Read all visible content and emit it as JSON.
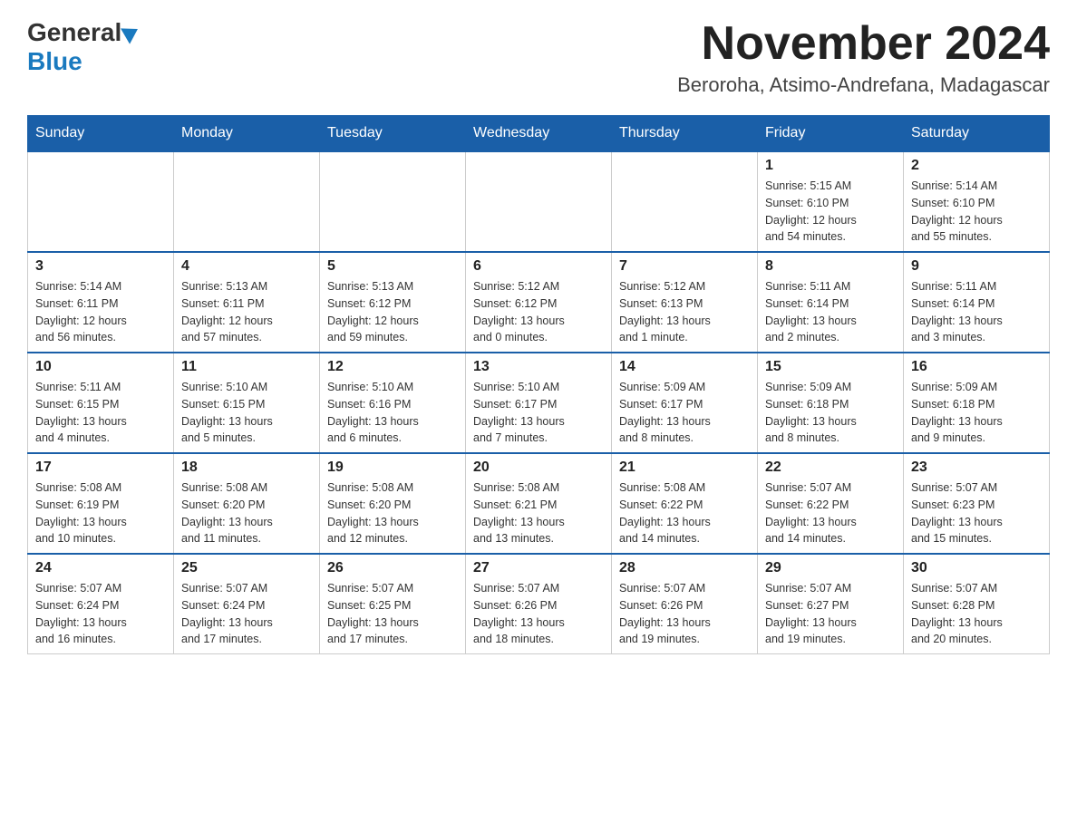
{
  "header": {
    "logo_general": "General",
    "logo_blue": "Blue",
    "month_title": "November 2024",
    "location": "Beroroha, Atsimo-Andrefana, Madagascar"
  },
  "weekdays": [
    "Sunday",
    "Monday",
    "Tuesday",
    "Wednesday",
    "Thursday",
    "Friday",
    "Saturday"
  ],
  "weeks": [
    [
      {
        "day": "",
        "info": ""
      },
      {
        "day": "",
        "info": ""
      },
      {
        "day": "",
        "info": ""
      },
      {
        "day": "",
        "info": ""
      },
      {
        "day": "",
        "info": ""
      },
      {
        "day": "1",
        "info": "Sunrise: 5:15 AM\nSunset: 6:10 PM\nDaylight: 12 hours\nand 54 minutes."
      },
      {
        "day": "2",
        "info": "Sunrise: 5:14 AM\nSunset: 6:10 PM\nDaylight: 12 hours\nand 55 minutes."
      }
    ],
    [
      {
        "day": "3",
        "info": "Sunrise: 5:14 AM\nSunset: 6:11 PM\nDaylight: 12 hours\nand 56 minutes."
      },
      {
        "day": "4",
        "info": "Sunrise: 5:13 AM\nSunset: 6:11 PM\nDaylight: 12 hours\nand 57 minutes."
      },
      {
        "day": "5",
        "info": "Sunrise: 5:13 AM\nSunset: 6:12 PM\nDaylight: 12 hours\nand 59 minutes."
      },
      {
        "day": "6",
        "info": "Sunrise: 5:12 AM\nSunset: 6:12 PM\nDaylight: 13 hours\nand 0 minutes."
      },
      {
        "day": "7",
        "info": "Sunrise: 5:12 AM\nSunset: 6:13 PM\nDaylight: 13 hours\nand 1 minute."
      },
      {
        "day": "8",
        "info": "Sunrise: 5:11 AM\nSunset: 6:14 PM\nDaylight: 13 hours\nand 2 minutes."
      },
      {
        "day": "9",
        "info": "Sunrise: 5:11 AM\nSunset: 6:14 PM\nDaylight: 13 hours\nand 3 minutes."
      }
    ],
    [
      {
        "day": "10",
        "info": "Sunrise: 5:11 AM\nSunset: 6:15 PM\nDaylight: 13 hours\nand 4 minutes."
      },
      {
        "day": "11",
        "info": "Sunrise: 5:10 AM\nSunset: 6:15 PM\nDaylight: 13 hours\nand 5 minutes."
      },
      {
        "day": "12",
        "info": "Sunrise: 5:10 AM\nSunset: 6:16 PM\nDaylight: 13 hours\nand 6 minutes."
      },
      {
        "day": "13",
        "info": "Sunrise: 5:10 AM\nSunset: 6:17 PM\nDaylight: 13 hours\nand 7 minutes."
      },
      {
        "day": "14",
        "info": "Sunrise: 5:09 AM\nSunset: 6:17 PM\nDaylight: 13 hours\nand 8 minutes."
      },
      {
        "day": "15",
        "info": "Sunrise: 5:09 AM\nSunset: 6:18 PM\nDaylight: 13 hours\nand 8 minutes."
      },
      {
        "day": "16",
        "info": "Sunrise: 5:09 AM\nSunset: 6:18 PM\nDaylight: 13 hours\nand 9 minutes."
      }
    ],
    [
      {
        "day": "17",
        "info": "Sunrise: 5:08 AM\nSunset: 6:19 PM\nDaylight: 13 hours\nand 10 minutes."
      },
      {
        "day": "18",
        "info": "Sunrise: 5:08 AM\nSunset: 6:20 PM\nDaylight: 13 hours\nand 11 minutes."
      },
      {
        "day": "19",
        "info": "Sunrise: 5:08 AM\nSunset: 6:20 PM\nDaylight: 13 hours\nand 12 minutes."
      },
      {
        "day": "20",
        "info": "Sunrise: 5:08 AM\nSunset: 6:21 PM\nDaylight: 13 hours\nand 13 minutes."
      },
      {
        "day": "21",
        "info": "Sunrise: 5:08 AM\nSunset: 6:22 PM\nDaylight: 13 hours\nand 14 minutes."
      },
      {
        "day": "22",
        "info": "Sunrise: 5:07 AM\nSunset: 6:22 PM\nDaylight: 13 hours\nand 14 minutes."
      },
      {
        "day": "23",
        "info": "Sunrise: 5:07 AM\nSunset: 6:23 PM\nDaylight: 13 hours\nand 15 minutes."
      }
    ],
    [
      {
        "day": "24",
        "info": "Sunrise: 5:07 AM\nSunset: 6:24 PM\nDaylight: 13 hours\nand 16 minutes."
      },
      {
        "day": "25",
        "info": "Sunrise: 5:07 AM\nSunset: 6:24 PM\nDaylight: 13 hours\nand 17 minutes."
      },
      {
        "day": "26",
        "info": "Sunrise: 5:07 AM\nSunset: 6:25 PM\nDaylight: 13 hours\nand 17 minutes."
      },
      {
        "day": "27",
        "info": "Sunrise: 5:07 AM\nSunset: 6:26 PM\nDaylight: 13 hours\nand 18 minutes."
      },
      {
        "day": "28",
        "info": "Sunrise: 5:07 AM\nSunset: 6:26 PM\nDaylight: 13 hours\nand 19 minutes."
      },
      {
        "day": "29",
        "info": "Sunrise: 5:07 AM\nSunset: 6:27 PM\nDaylight: 13 hours\nand 19 minutes."
      },
      {
        "day": "30",
        "info": "Sunrise: 5:07 AM\nSunset: 6:28 PM\nDaylight: 13 hours\nand 20 minutes."
      }
    ]
  ]
}
